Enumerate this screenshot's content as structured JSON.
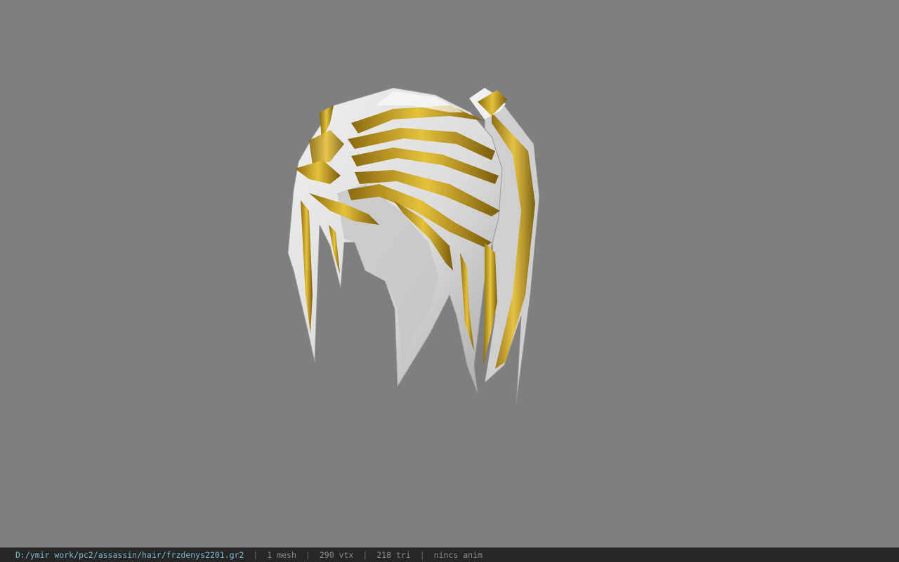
{
  "viewport": {
    "background_color": "#7f7f7f",
    "model": {
      "name": "hair mesh",
      "base_color": "#e2e2e2",
      "stripe_color": "#c9a21c",
      "shadow_color": "#9e9e9e"
    }
  },
  "statusbar": {
    "file_path": "D:/ymir work/pc2/assassin/hair/frzdenys2201.gr2",
    "separator": "|",
    "mesh_count": "1 mesh",
    "vertex_count": "290 vtx",
    "triangle_count": "218 tri",
    "anim_status": "nincs anim"
  }
}
